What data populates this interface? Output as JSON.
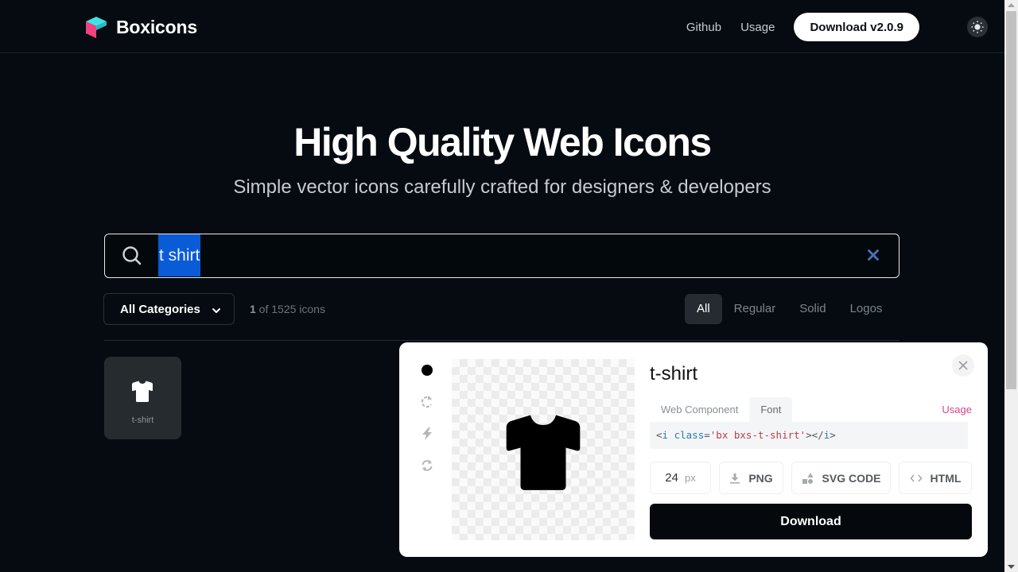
{
  "header": {
    "brand": "Boxicons",
    "nav": [
      {
        "label": "Github"
      },
      {
        "label": "Usage"
      }
    ],
    "download_label": "Download v2.0.9",
    "theme_icon": "sun-icon"
  },
  "hero": {
    "title": "High Quality Web Icons",
    "subtitle": "Simple vector icons carefully crafted for designers & developers"
  },
  "search": {
    "value": "t shirt",
    "placeholder": "",
    "selected": true,
    "icon": "search-icon",
    "clear_icon": "close-icon"
  },
  "filters": {
    "category": "All Categories",
    "count_current": "1",
    "count_rest": " of 1525 icons",
    "types": [
      {
        "label": "All",
        "active": true
      },
      {
        "label": "Regular",
        "active": false
      },
      {
        "label": "Solid",
        "active": false
      },
      {
        "label": "Logos",
        "active": false
      }
    ]
  },
  "results": [
    {
      "name": "t-shirt",
      "icon": "t-shirt-icon"
    }
  ],
  "detail": {
    "title": "t-shirt",
    "variants": [
      {
        "name": "solid",
        "icon": "dot-icon",
        "active": true
      },
      {
        "name": "spin",
        "icon": "rotate-icon",
        "active": false
      },
      {
        "name": "flash",
        "icon": "bolt-icon",
        "active": false
      },
      {
        "name": "refresh",
        "icon": "refresh-icon",
        "active": false
      }
    ],
    "code_tabs": [
      {
        "label": "Web Component",
        "active": false
      },
      {
        "label": "Font",
        "active": true
      }
    ],
    "usage_link": "Usage",
    "code": {
      "open": "<",
      "tag": "i",
      "attr": "class",
      "eq": "=",
      "value": "'bx bxs-t-shirt'",
      "close_open": "></",
      "close_tag": "i",
      "end": ">"
    },
    "size": "24",
    "size_unit": "px",
    "actions": {
      "png": "PNG",
      "svg": "SVG CODE",
      "html": "HTML"
    },
    "download_label": "Download"
  },
  "colors": {
    "background": "#050b11",
    "accent_selection": "#0a5bd6",
    "usage_link": "#d5468f",
    "brand_cyan": "#2fd0d8",
    "brand_pink": "#f0427e"
  }
}
